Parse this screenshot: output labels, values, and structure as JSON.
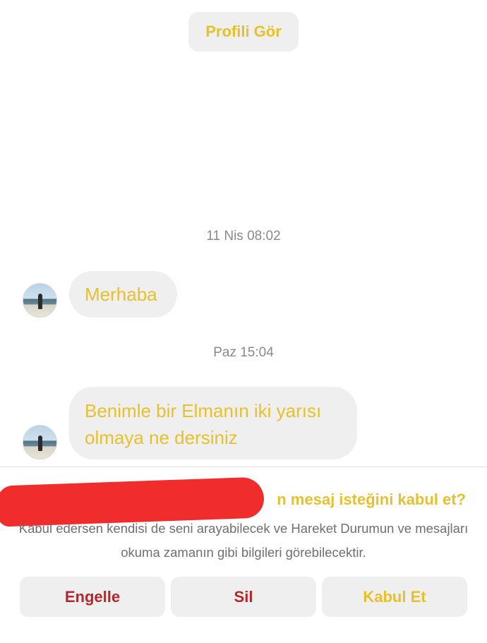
{
  "header": {
    "profile_button_label": "Profili Gör"
  },
  "messages": [
    {
      "timestamp": "11 Nis 08:02",
      "text": "Merhaba"
    },
    {
      "timestamp": "Paz 15:04",
      "text": "Benimle bir Elmanın iki yarısı olmaya ne dersiniz"
    }
  ],
  "request_panel": {
    "title_visible": "n mesaj isteğini kabul et?",
    "description": "Kabul edersen kendisi de seni arayabilecek ve Hareket Durumun ve mesajları okuma zamanın gibi bilgileri görebilecektir.",
    "buttons": {
      "block_label": "Engelle",
      "delete_label": "Sil",
      "accept_label": "Kabul Et"
    }
  },
  "colors": {
    "accent": "#e6c12c",
    "danger": "#b3272d",
    "bubble_bg": "#efefef",
    "redaction": "#f02c2c"
  }
}
